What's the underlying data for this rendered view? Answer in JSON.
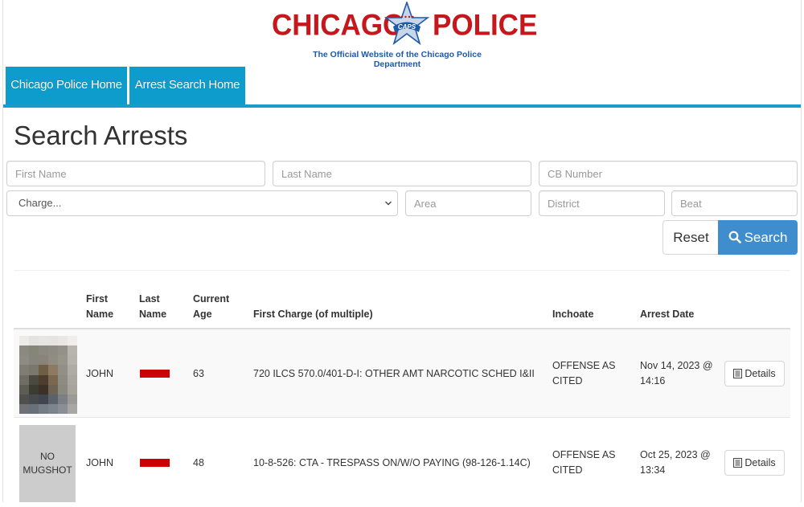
{
  "header": {
    "logo_left": "CHICAGO",
    "logo_badge": "CAPS",
    "logo_right": "POLICE",
    "tagline": "The Official Website of the Chicago Police Department",
    "colors": {
      "brand_red": "#c8161d",
      "brand_blue": "#1c5aa6",
      "nav_blue": "#0e9ccd"
    }
  },
  "nav": {
    "tabs": [
      {
        "label": "Chicago Police Home"
      },
      {
        "label": "Arrest Search Home"
      }
    ]
  },
  "page": {
    "title": "Search Arrests"
  },
  "form": {
    "first_name": {
      "placeholder": "First Name",
      "value": ""
    },
    "last_name": {
      "placeholder": "Last Name",
      "value": ""
    },
    "cb_number": {
      "placeholder": "CB Number",
      "value": ""
    },
    "charge": {
      "selected": "Charge..."
    },
    "area": {
      "placeholder": "Area",
      "value": ""
    },
    "district": {
      "placeholder": "District",
      "value": ""
    },
    "beat": {
      "placeholder": "Beat",
      "value": ""
    },
    "reset_label": "Reset",
    "search_label": "Search",
    "search_color": "#3f8dcc"
  },
  "table": {
    "headers": {
      "first_name": [
        "First",
        "Name"
      ],
      "last_name": [
        "Last",
        "Name"
      ],
      "age": [
        "Current",
        "Age"
      ],
      "charge": "First Charge (of multiple)",
      "inchoate": "Inchoate",
      "arrest_date": "Arrest Date"
    },
    "rows": [
      {
        "photo": "pixelated-mugshot",
        "first_name": "JOHN",
        "last_name": "[redacted]",
        "age": "63",
        "charge": "720 ILCS 570.0/401-D-I: OTHER AMT NARCOTIC SCHED I&II",
        "inchoate": [
          "OFFENSE AS",
          "CITED"
        ],
        "arrest_date": [
          "Nov 14, 2023 @",
          "14:16"
        ],
        "details_label": "Details"
      },
      {
        "photo": "none",
        "no_mugshot": [
          "NO",
          "MUGSHOT"
        ],
        "first_name": "JOHN",
        "last_name": "[redacted]",
        "age": "48",
        "charge": "10-8-526: CTA - TRESPASS ON/W/O PAYING (98-126-1.14C)",
        "inchoate": [
          "OFFENSE AS",
          "CITED"
        ],
        "arrest_date": [
          "Oct 25, 2023 @",
          "13:34"
        ],
        "details_label": "Details"
      }
    ],
    "redaction_color": "#cc0000"
  }
}
